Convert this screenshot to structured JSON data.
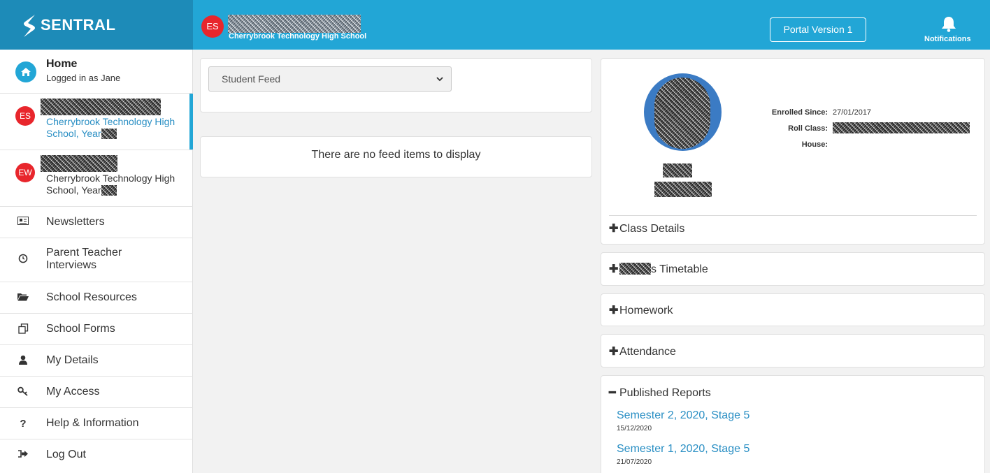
{
  "brand": {
    "name": "SENTRAL"
  },
  "header": {
    "student_initials": "ES",
    "school": "Cherrybrook Technology High School",
    "portal_button": "Portal Version 1",
    "notifications_label": "Notifications"
  },
  "sidebar": {
    "home": {
      "title": "Home",
      "subtitle": "Logged in as Jane"
    },
    "students": [
      {
        "initials": "ES",
        "school": "Cherrybrook Technology High School, Year",
        "active": true
      },
      {
        "initials": "EW",
        "school": "Cherrybrook Technology High School, Year",
        "active": false
      }
    ],
    "menu": [
      {
        "label": "Newsletters",
        "icon": "newspaper-icon"
      },
      {
        "label": "Parent Teacher Interviews",
        "icon": "clock-icon"
      },
      {
        "label": "School Resources",
        "icon": "folder-icon"
      },
      {
        "label": "School Forms",
        "icon": "forms-icon"
      },
      {
        "label": "My Details",
        "icon": "user-icon"
      },
      {
        "label": "My Access",
        "icon": "key-icon"
      },
      {
        "label": "Help & Information",
        "icon": "question-icon"
      },
      {
        "label": "Log Out",
        "icon": "logout-icon"
      }
    ]
  },
  "feed": {
    "select_value": "Student Feed",
    "empty_message": "There are no feed items to display"
  },
  "profile": {
    "enrolled_label": "Enrolled Since:",
    "enrolled_value": "27/01/2017",
    "roll_class_label": "Roll Class:",
    "house_label": "House:"
  },
  "sections": {
    "class_details": "Class Details",
    "timetable_suffix": "s Timetable",
    "homework": "Homework",
    "attendance": "Attendance",
    "published_reports": "Published Reports"
  },
  "reports": [
    {
      "title": "Semester 2, 2020, Stage 5",
      "date": "15/12/2020"
    },
    {
      "title": "Semester 1, 2020, Stage 5",
      "date": "21/07/2020"
    }
  ],
  "colors": {
    "brand_blue": "#22a6d6",
    "avatar_red": "#e8262c",
    "link_blue": "#2a8fc4"
  }
}
